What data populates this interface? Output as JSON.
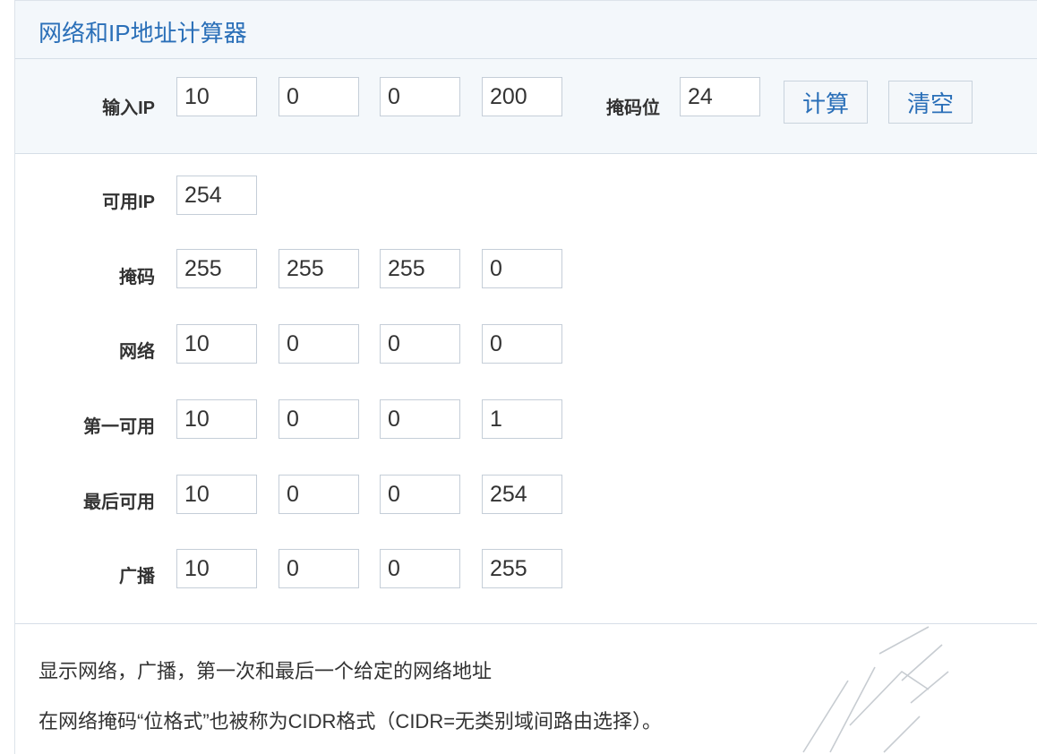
{
  "title": "网络和IP地址计算器",
  "input": {
    "label": "输入IP",
    "ip": [
      "10",
      "0",
      "0",
      "200"
    ],
    "mask_label": "掩码位",
    "mask_bits": "24",
    "calc_button": "计算",
    "clear_button": "清空"
  },
  "results": {
    "usable": {
      "label": "可用IP",
      "value": "254"
    },
    "mask": {
      "label": "掩码",
      "octets": [
        "255",
        "255",
        "255",
        "0"
      ]
    },
    "network": {
      "label": "网络",
      "octets": [
        "10",
        "0",
        "0",
        "0"
      ]
    },
    "first": {
      "label": "第一可用",
      "octets": [
        "10",
        "0",
        "0",
        "1"
      ]
    },
    "last": {
      "label": "最后可用",
      "octets": [
        "10",
        "0",
        "0",
        "254"
      ]
    },
    "broadcast": {
      "label": "广播",
      "octets": [
        "10",
        "0",
        "0",
        "255"
      ]
    }
  },
  "description": {
    "line1": "显示网络，广播，第一次和最后一个给定的网络地址",
    "line2": "在网络掩码“位格式”也被称为CIDR格式（CIDR=无类别域间路由选择）。"
  },
  "colors": {
    "accent": "#2a6fb8",
    "header_bg": "#f3f7fb",
    "border": "#c5ced8"
  }
}
